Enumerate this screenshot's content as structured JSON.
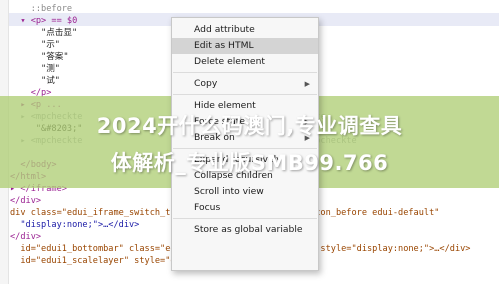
{
  "code_lines": [
    {
      "text": "    ::before",
      "cls": "t-gray"
    },
    {
      "text": "  ▾ <p> == $0",
      "cls": "t-tag"
    },
    {
      "text": "      \"点击显\"",
      "cls": "t-str"
    },
    {
      "text": "      \"示\"",
      "cls": "t-str"
    },
    {
      "text": "      \"答案\"",
      "cls": "t-str"
    },
    {
      "text": "      \"测\"",
      "cls": "t-str"
    },
    {
      "text": "      \"试\"",
      "cls": "t-str"
    },
    {
      "text": "    </p>",
      "cls": "t-tag"
    },
    {
      "text": "  ▸ <p ...",
      "cls": "t-tag"
    },
    {
      "text": "  ▸ <mpcheckte                                      mpcheckte",
      "cls": "t-dim"
    },
    {
      "text": "     \"&#8203;\"",
      "cls": "t-str"
    },
    {
      "text": "  ▸ <mpcheckte                        2591984375209893\"  /mpcheckte",
      "cls": "t-dim"
    },
    {
      "text": "                                                              ",
      "cls": "t-dim"
    },
    {
      "text": "  </body>",
      "cls": "t-tag"
    },
    {
      "text": "</html>",
      "cls": "t-tag"
    },
    {
      "text": "▸ </iframe>",
      "cls": "t-tag"
    },
    {
      "text": "</div>",
      "cls": "t-tag"
    },
    {
      "text": "div class=\"edui_iframe_switch_tips _               k_text icon_before edui-default\"",
      "cls": "t-attr"
    },
    {
      "text": "  \"display:none;\">…</div>",
      "cls": "t-val"
    },
    {
      "text": "</div>",
      "cls": "t-tag"
    },
    {
      "text": "  id=\"edui1_bottombar\" class=\"edui-e                efault\" style=\"display:none;\">…</div>",
      "cls": "t-attr"
    },
    {
      "text": "  id=\"edui1_scalelayer\" style=\"dis                  </div>",
      "cls": "t-attr"
    },
    {
      "text": "",
      "cls": "t-dim"
    }
  ],
  "menu": {
    "items": [
      {
        "label": "Add attribute",
        "name": "menu-add-attribute",
        "highlight": false,
        "submenu": false
      },
      {
        "label": "Edit as HTML",
        "name": "menu-edit-as-html",
        "highlight": true,
        "submenu": false
      },
      {
        "label": "Delete element",
        "name": "menu-delete-element",
        "highlight": false,
        "submenu": false
      },
      {
        "sep": true
      },
      {
        "label": "Copy",
        "name": "menu-copy",
        "highlight": false,
        "submenu": true
      },
      {
        "sep": true
      },
      {
        "label": "Hide element",
        "name": "menu-hide-element",
        "highlight": false,
        "submenu": false
      },
      {
        "label": "Force state",
        "name": "menu-force-state",
        "highlight": false,
        "submenu": true
      },
      {
        "label": "Break on",
        "name": "menu-break-on",
        "highlight": false,
        "submenu": true
      },
      {
        "sep": true
      },
      {
        "label": "Expand recursively",
        "name": "menu-expand-recursively",
        "highlight": false,
        "submenu": false
      },
      {
        "label": "Collapse children",
        "name": "menu-collapse-children",
        "highlight": false,
        "submenu": false
      },
      {
        "label": "Scroll into view",
        "name": "menu-scroll-into-view",
        "highlight": false,
        "submenu": false
      },
      {
        "label": "Focus",
        "name": "menu-focus",
        "highlight": false,
        "submenu": false
      },
      {
        "sep": true
      },
      {
        "label": "Store as global variable",
        "name": "menu-store-as-global-variable",
        "highlight": false,
        "submenu": false
      }
    ]
  },
  "banner": {
    "line1": "2024开什么码澳门,专业调查具",
    "line2": "体解析_专业版SMB99.766"
  },
  "colors": {
    "banner_overlay": "#b0ce76",
    "menu_highlight": "#d4d4d4",
    "tag": "#9b2393"
  }
}
